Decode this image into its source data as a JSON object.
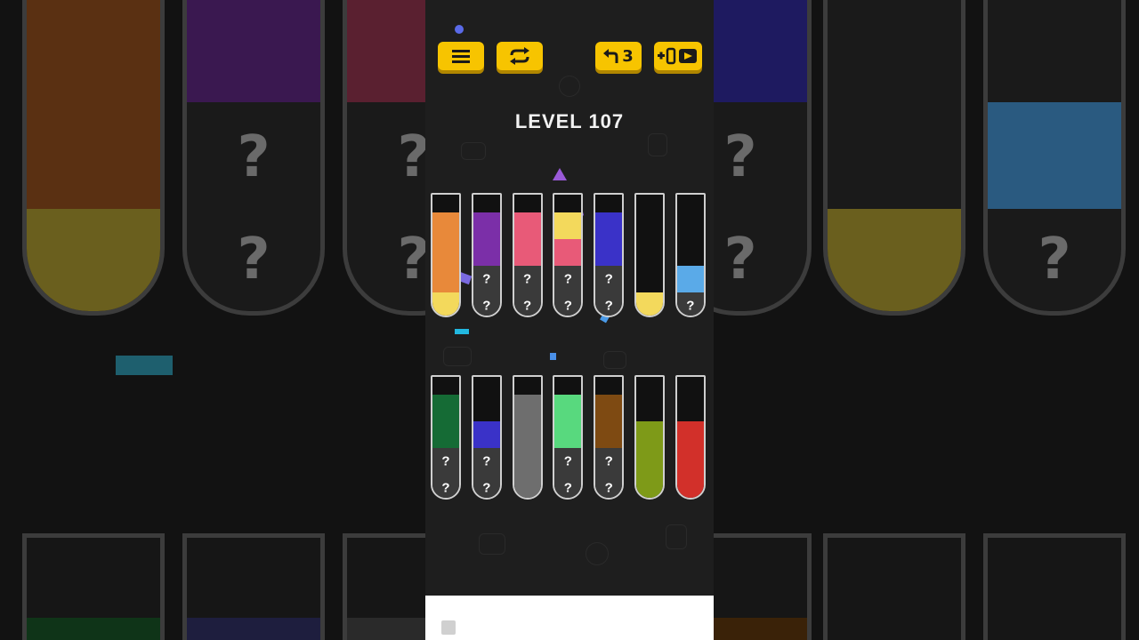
{
  "hud": {
    "undo_count": "3",
    "icons": [
      "menu-icon",
      "restart-icon",
      "undo-icon",
      "add-tube-video-icon"
    ]
  },
  "level_title": "LEVEL 107",
  "hidden_marker": "?",
  "colors": {
    "orange": "#e8893a",
    "yellow": "#f3d95c",
    "purple": "#7b2fa8",
    "pink": "#e85a78",
    "blue": "#3a32c8",
    "lightblue": "#5aaae8",
    "darkgreen": "#156b35",
    "gray": "#6e6e6e",
    "mint": "#58d97e",
    "brown": "#7e4a12",
    "olive": "#7e9a18",
    "red": "#d2302a",
    "hidden": "#3a3a3a",
    "accent": "#f7c400"
  },
  "tubes_top": [
    {
      "layers": [
        "empty",
        "orange",
        "orange",
        "orange",
        "yellow"
      ]
    },
    {
      "layers": [
        "empty",
        "purple",
        "purple",
        "hidden",
        "hidden"
      ]
    },
    {
      "layers": [
        "empty",
        "pink",
        "pink",
        "hidden",
        "hidden"
      ]
    },
    {
      "layers": [
        "empty",
        "yellow",
        "pink",
        "hidden",
        "hidden"
      ]
    },
    {
      "layers": [
        "empty",
        "blue",
        "blue",
        "hidden",
        "hidden"
      ]
    },
    {
      "layers": [
        "empty",
        "empty",
        "empty",
        "empty",
        "yellow"
      ]
    },
    {
      "layers": [
        "empty",
        "empty",
        "empty",
        "lightblue",
        "hidden"
      ]
    }
  ],
  "tubes_bottom": [
    {
      "layers": [
        "empty",
        "darkgreen",
        "darkgreen",
        "hidden",
        "hidden"
      ]
    },
    {
      "layers": [
        "empty",
        "empty",
        "blue",
        "hidden",
        "hidden"
      ]
    },
    {
      "layers": [
        "empty",
        "gray",
        "gray",
        "gray",
        "gray"
      ]
    },
    {
      "layers": [
        "empty",
        "mint",
        "mint",
        "hidden",
        "hidden"
      ]
    },
    {
      "layers": [
        "empty",
        "brown",
        "brown",
        "hidden",
        "hidden"
      ]
    },
    {
      "layers": [
        "empty",
        "empty",
        "olive",
        "olive",
        "olive"
      ]
    },
    {
      "layers": [
        "empty",
        "empty",
        "red",
        "red",
        "red"
      ]
    }
  ]
}
